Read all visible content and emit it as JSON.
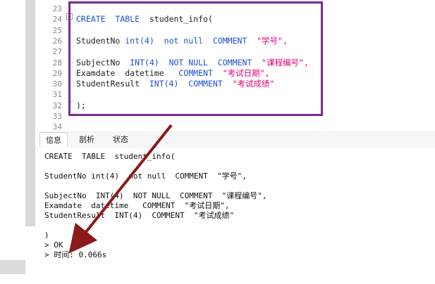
{
  "editor": {
    "lines": [
      {
        "num": "23",
        "text": ""
      },
      {
        "num": "24",
        "parts": [
          {
            "t": "CREATE",
            "c": "kw"
          },
          {
            "t": "  "
          },
          {
            "t": "TABLE",
            "c": "kw"
          },
          {
            "t": "  student_info(",
            "c": "plain"
          }
        ]
      },
      {
        "num": "25",
        "text": ""
      },
      {
        "num": "26",
        "parts": [
          {
            "t": "StudentNo ",
            "c": "plain"
          },
          {
            "t": "int(4)",
            "c": "kw"
          },
          {
            "t": "  "
          },
          {
            "t": "not null",
            "c": "kw"
          },
          {
            "t": "  "
          },
          {
            "t": "COMMENT",
            "c": "kw"
          },
          {
            "t": "  "
          },
          {
            "t": "\"学号\",",
            "c": "str"
          }
        ]
      },
      {
        "num": "27",
        "text": ""
      },
      {
        "num": "28",
        "parts": [
          {
            "t": "SubjectNo  ",
            "c": "plain"
          },
          {
            "t": "INT(4)",
            "c": "kw"
          },
          {
            "t": "  "
          },
          {
            "t": "NOT NULL",
            "c": "kw"
          },
          {
            "t": "  "
          },
          {
            "t": "COMMENT",
            "c": "kw"
          },
          {
            "t": "  "
          },
          {
            "t": "\"课程编号\",",
            "c": "str"
          }
        ]
      },
      {
        "num": "29",
        "parts": [
          {
            "t": "Examdate  datetime   ",
            "c": "plain"
          },
          {
            "t": "COMMENT",
            "c": "kw"
          },
          {
            "t": "  "
          },
          {
            "t": "\"考试日期\",",
            "c": "str"
          }
        ]
      },
      {
        "num": "30",
        "parts": [
          {
            "t": "StudentResult  ",
            "c": "plain"
          },
          {
            "t": "INT(4)",
            "c": "kw"
          },
          {
            "t": "  "
          },
          {
            "t": "COMMENT",
            "c": "kw"
          },
          {
            "t": "  "
          },
          {
            "t": "\"考试成绩\"",
            "c": "str"
          }
        ]
      },
      {
        "num": "31",
        "text": ""
      },
      {
        "num": "32",
        "parts": [
          {
            "t": ");",
            "c": "plain"
          }
        ]
      },
      {
        "num": "33",
        "text": ""
      },
      {
        "num": "34",
        "text": ""
      }
    ]
  },
  "tabs": [
    {
      "label": "信息",
      "active": true
    },
    {
      "label": "剖析",
      "active": false
    },
    {
      "label": "状态",
      "active": false
    }
  ],
  "output": {
    "lines": [
      "CREATE  TABLE  student_info(",
      "",
      "StudentNo int(4)  not null  COMMENT  \"学号\",",
      "",
      "SubjectNo  INT(4)  NOT NULL  COMMENT  \"课程编号\",",
      "Examdate  datetime   COMMENT  \"考试日期\",",
      "StudentResult  INT(4)  COMMENT  \"考试成绩\"",
      "",
      ")",
      "> OK",
      "> 时间: 0.066s"
    ]
  },
  "colors": {
    "keyword": "#1a4fd6",
    "string": "#e0007a",
    "highlight_box": "#7a2a8f",
    "arrow": "#8b1a1a"
  }
}
